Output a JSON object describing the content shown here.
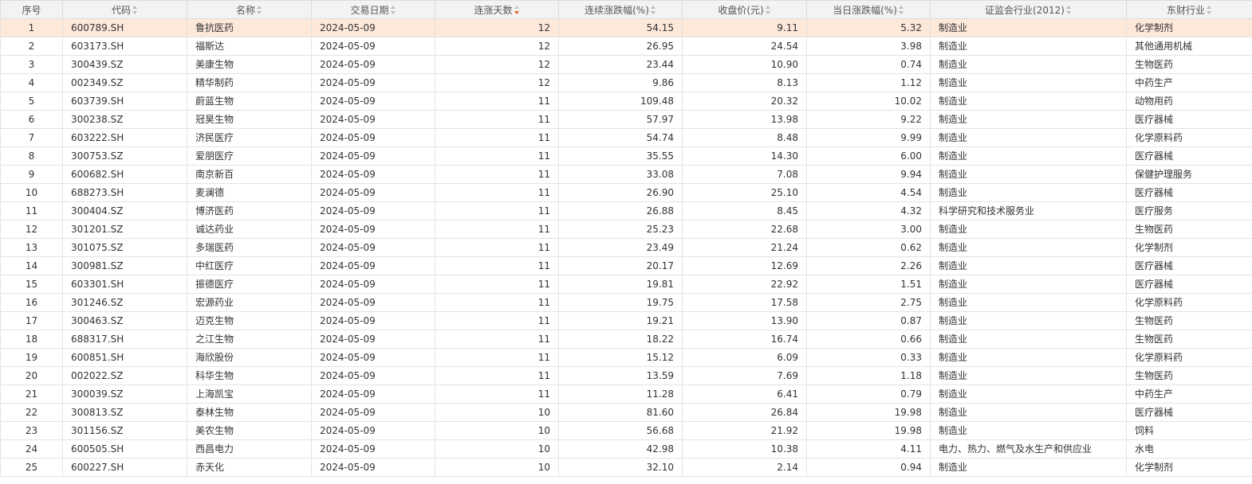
{
  "table": {
    "headers": [
      {
        "label": "序号",
        "sort": ""
      },
      {
        "label": "代码",
        "sort": "none"
      },
      {
        "label": "名称",
        "sort": "none"
      },
      {
        "label": "交易日期",
        "sort": "none"
      },
      {
        "label": "连涨天数",
        "sort": "desc"
      },
      {
        "label": "连续涨跌幅(%)",
        "sort": "none"
      },
      {
        "label": "收盘价(元)",
        "sort": "none"
      },
      {
        "label": "当日涨跌幅(%)",
        "sort": "none"
      },
      {
        "label": "证监会行业(2012)",
        "sort": "none"
      },
      {
        "label": "东财行业",
        "sort": "none"
      }
    ],
    "selected_row": 0,
    "rows": [
      [
        "1",
        "600789.SH",
        "鲁抗医药",
        "2024-05-09",
        "12",
        "54.15",
        "9.11",
        "5.32",
        "制造业",
        "化学制剂"
      ],
      [
        "2",
        "603173.SH",
        "福斯达",
        "2024-05-09",
        "12",
        "26.95",
        "24.54",
        "3.98",
        "制造业",
        "其他通用机械"
      ],
      [
        "3",
        "300439.SZ",
        "美康生物",
        "2024-05-09",
        "12",
        "23.44",
        "10.90",
        "0.74",
        "制造业",
        "生物医药"
      ],
      [
        "4",
        "002349.SZ",
        "精华制药",
        "2024-05-09",
        "12",
        "9.86",
        "8.13",
        "1.12",
        "制造业",
        "中药生产"
      ],
      [
        "5",
        "603739.SH",
        "蔚蓝生物",
        "2024-05-09",
        "11",
        "109.48",
        "20.32",
        "10.02",
        "制造业",
        "动物用药"
      ],
      [
        "6",
        "300238.SZ",
        "冠昊生物",
        "2024-05-09",
        "11",
        "57.97",
        "13.98",
        "9.22",
        "制造业",
        "医疗器械"
      ],
      [
        "7",
        "603222.SH",
        "济民医疗",
        "2024-05-09",
        "11",
        "54.74",
        "8.48",
        "9.99",
        "制造业",
        "化学原料药"
      ],
      [
        "8",
        "300753.SZ",
        "爱朋医疗",
        "2024-05-09",
        "11",
        "35.55",
        "14.30",
        "6.00",
        "制造业",
        "医疗器械"
      ],
      [
        "9",
        "600682.SH",
        "南京新百",
        "2024-05-09",
        "11",
        "33.08",
        "7.08",
        "9.94",
        "制造业",
        "保健护理服务"
      ],
      [
        "10",
        "688273.SH",
        "麦澜德",
        "2024-05-09",
        "11",
        "26.90",
        "25.10",
        "4.54",
        "制造业",
        "医疗器械"
      ],
      [
        "11",
        "300404.SZ",
        "博济医药",
        "2024-05-09",
        "11",
        "26.88",
        "8.45",
        "4.32",
        "科学研究和技术服务业",
        "医疗服务"
      ],
      [
        "12",
        "301201.SZ",
        "诚达药业",
        "2024-05-09",
        "11",
        "25.23",
        "22.68",
        "3.00",
        "制造业",
        "生物医药"
      ],
      [
        "13",
        "301075.SZ",
        "多瑞医药",
        "2024-05-09",
        "11",
        "23.49",
        "21.24",
        "0.62",
        "制造业",
        "化学制剂"
      ],
      [
        "14",
        "300981.SZ",
        "中红医疗",
        "2024-05-09",
        "11",
        "20.17",
        "12.69",
        "2.26",
        "制造业",
        "医疗器械"
      ],
      [
        "15",
        "603301.SH",
        "振德医疗",
        "2024-05-09",
        "11",
        "19.81",
        "22.92",
        "1.51",
        "制造业",
        "医疗器械"
      ],
      [
        "16",
        "301246.SZ",
        "宏源药业",
        "2024-05-09",
        "11",
        "19.75",
        "17.58",
        "2.75",
        "制造业",
        "化学原料药"
      ],
      [
        "17",
        "300463.SZ",
        "迈克生物",
        "2024-05-09",
        "11",
        "19.21",
        "13.90",
        "0.87",
        "制造业",
        "生物医药"
      ],
      [
        "18",
        "688317.SH",
        "之江生物",
        "2024-05-09",
        "11",
        "18.22",
        "16.74",
        "0.66",
        "制造业",
        "生物医药"
      ],
      [
        "19",
        "600851.SH",
        "海欣股份",
        "2024-05-09",
        "11",
        "15.12",
        "6.09",
        "0.33",
        "制造业",
        "化学原料药"
      ],
      [
        "20",
        "002022.SZ",
        "科华生物",
        "2024-05-09",
        "11",
        "13.59",
        "7.69",
        "1.18",
        "制造业",
        "生物医药"
      ],
      [
        "21",
        "300039.SZ",
        "上海凯宝",
        "2024-05-09",
        "11",
        "11.28",
        "6.41",
        "0.79",
        "制造业",
        "中药生产"
      ],
      [
        "22",
        "300813.SZ",
        "泰林生物",
        "2024-05-09",
        "10",
        "81.60",
        "26.84",
        "19.98",
        "制造业",
        "医疗器械"
      ],
      [
        "23",
        "301156.SZ",
        "美农生物",
        "2024-05-09",
        "10",
        "56.68",
        "21.92",
        "19.98",
        "制造业",
        "饲料"
      ],
      [
        "24",
        "600505.SH",
        "西昌电力",
        "2024-05-09",
        "10",
        "42.98",
        "10.38",
        "4.11",
        "电力、热力、燃气及水生产和供应业",
        "水电"
      ],
      [
        "25",
        "600227.SH",
        "赤天化",
        "2024-05-09",
        "10",
        "32.10",
        "2.14",
        "0.94",
        "制造业",
        "化学制剂"
      ]
    ]
  }
}
